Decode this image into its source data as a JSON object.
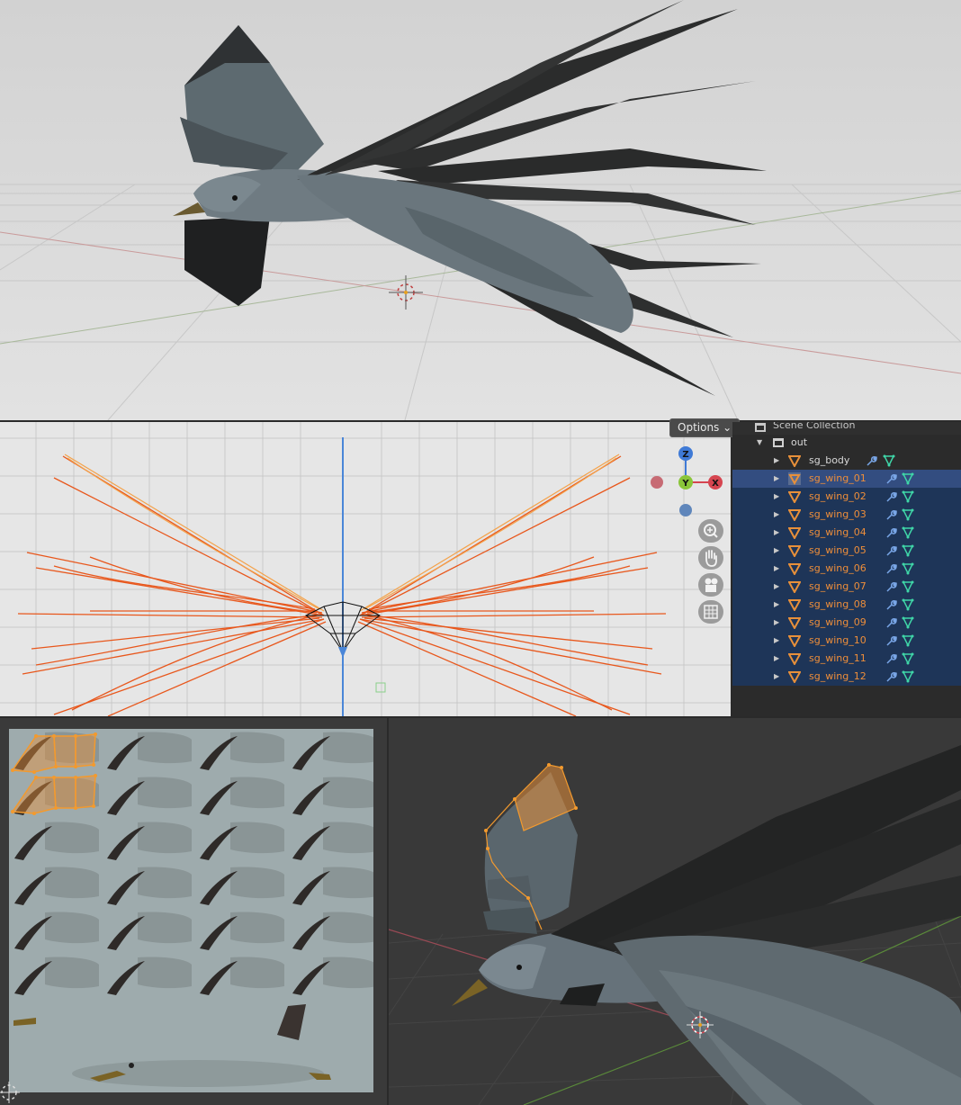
{
  "ortho_viewport": {
    "options_label": "Options",
    "options_chevron": "⌄",
    "axes": {
      "z": "Z",
      "y": "Y",
      "x": "X"
    },
    "tool_icons": [
      "zoom-icon",
      "hand-pan-icon",
      "camera-icon",
      "grid-icon"
    ]
  },
  "outliner": {
    "scene_collection": "Scene Collection",
    "collection": "out",
    "objects": [
      {
        "name": "sg_body"
      },
      {
        "name": "sg_wing_01"
      },
      {
        "name": "sg_wing_02"
      },
      {
        "name": "sg_wing_03"
      },
      {
        "name": "sg_wing_04"
      },
      {
        "name": "sg_wing_05"
      },
      {
        "name": "sg_wing_06"
      },
      {
        "name": "sg_wing_07"
      },
      {
        "name": "sg_wing_08"
      },
      {
        "name": "sg_wing_09"
      },
      {
        "name": "sg_wing_10"
      },
      {
        "name": "sg_wing_11"
      },
      {
        "name": "sg_wing_12"
      }
    ],
    "expander_glyph": "▶",
    "collection_expander_glyph": "▼"
  },
  "colors": {
    "selection_orange": "#ee8e3a",
    "wireframe_orange": "#e8571c",
    "outliner_selected": "#1e3558",
    "outliner_active": "#334d80",
    "axis_x": "#d64550",
    "axis_y": "#8ac53a",
    "axis_z": "#3f7ad6"
  }
}
